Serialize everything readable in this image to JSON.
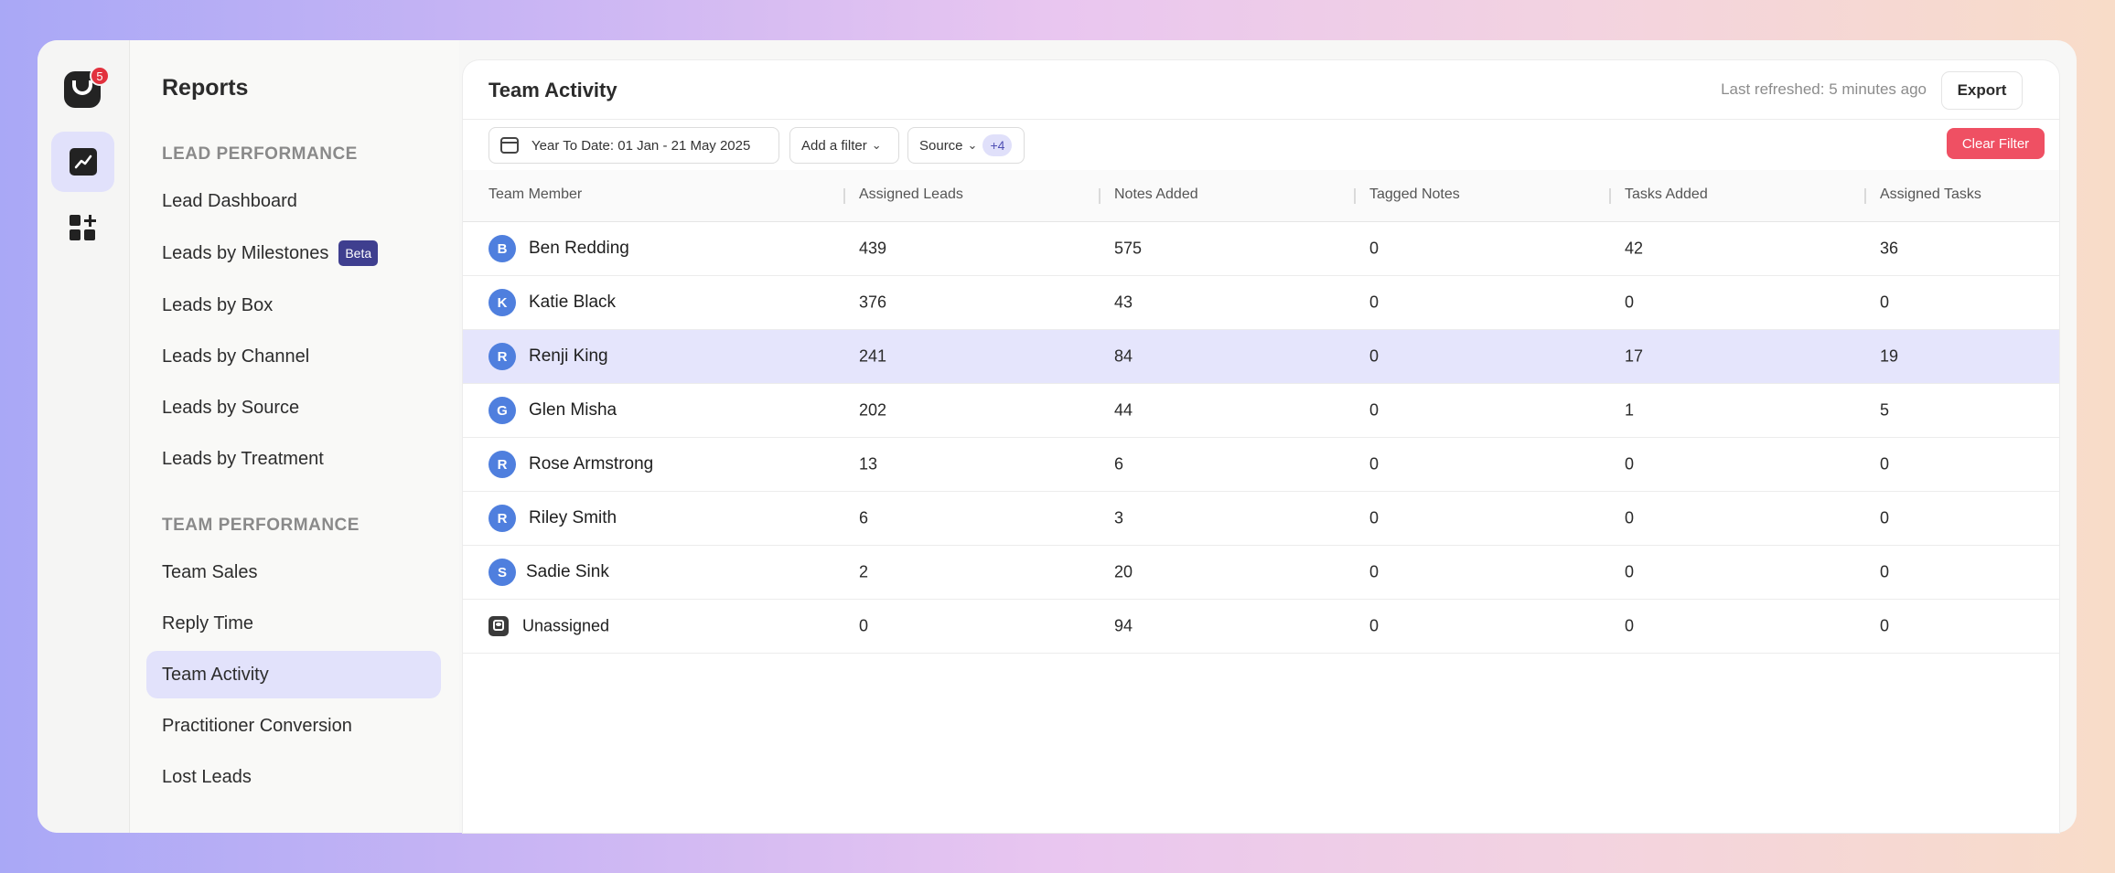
{
  "rail": {
    "notification_count": "5",
    "items": [
      {
        "icon": "chart-line-icon",
        "active": true
      },
      {
        "icon": "apps-add-icon",
        "active": false
      }
    ]
  },
  "sidebar": {
    "title": "Reports",
    "sections": [
      {
        "label": "LEAD PERFORMANCE",
        "items": [
          {
            "label": "Lead Dashboard"
          },
          {
            "label": "Leads by Milestones",
            "badge": "Beta"
          },
          {
            "label": "Leads by Box"
          },
          {
            "label": "Leads by Channel"
          },
          {
            "label": "Leads by Source"
          },
          {
            "label": "Leads by Treatment"
          }
        ]
      },
      {
        "label": "TEAM PERFORMANCE",
        "items": [
          {
            "label": "Team Sales"
          },
          {
            "label": "Reply Time"
          },
          {
            "label": "Team Activity",
            "active": true
          },
          {
            "label": "Practitioner Conversion"
          },
          {
            "label": "Lost Leads"
          }
        ]
      }
    ]
  },
  "main": {
    "title": "Team Activity",
    "last_refreshed": "Last refreshed: 5 minutes ago",
    "export_label": "Export",
    "filters": {
      "date_range": "Year To Date: 01 Jan - 21 May 2025",
      "add_filter": "Add a filter",
      "source_label": "Source",
      "source_extra": "+4",
      "clear_label": "Clear Filter"
    },
    "table": {
      "columns": [
        "Team Member",
        "Assigned Leads",
        "Notes Added",
        "Tagged Notes",
        "Tasks Added",
        "Assigned Tasks"
      ],
      "rows": [
        {
          "initial": "B",
          "name": "Ben Redding",
          "values": [
            "439",
            "575",
            "0",
            "42",
            "36"
          ]
        },
        {
          "initial": "K",
          "name": "Katie Black",
          "values": [
            "376",
            "43",
            "0",
            "0",
            "0"
          ]
        },
        {
          "initial": "R",
          "name": "Renji King",
          "values": [
            "241",
            "84",
            "0",
            "17",
            "19"
          ],
          "highlighted": true
        },
        {
          "initial": "G",
          "name": "Glen Misha",
          "values": [
            "202",
            "44",
            "0",
            "1",
            "5"
          ]
        },
        {
          "initial": "R",
          "name": "Rose Armstrong",
          "values": [
            "13",
            "6",
            "0",
            "0",
            "0"
          ]
        },
        {
          "initial": "R",
          "name": "Riley Smith",
          "values": [
            "6",
            "3",
            "0",
            "0",
            "0"
          ]
        },
        {
          "initial": "S",
          "name": "Sadie Sink",
          "values": [
            "2",
            "20",
            "0",
            "0",
            "0"
          ]
        },
        {
          "initial": "",
          "name": "Unassigned",
          "values": [
            "0",
            "94",
            "0",
            "0",
            "0"
          ],
          "unassigned": true
        }
      ]
    }
  }
}
